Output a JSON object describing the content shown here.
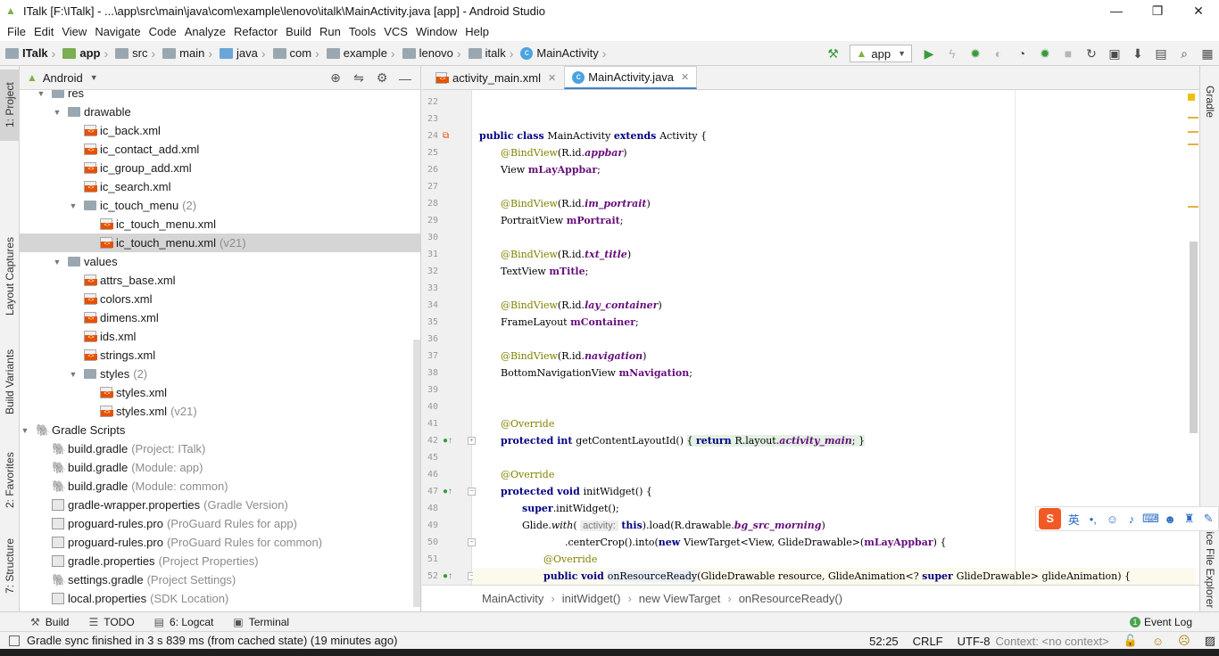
{
  "window": {
    "title": "ITalk [F:\\ITalk] - ...\\app\\src\\main\\java\\com\\example\\lenovo\\italk\\MainActivity.java [app] - Android Studio",
    "minimize": "—",
    "restore": "❐",
    "close": "✕"
  },
  "menu": [
    {
      "label": "File"
    },
    {
      "label": "Edit"
    },
    {
      "label": "View"
    },
    {
      "label": "Navigate"
    },
    {
      "label": "Code"
    },
    {
      "label": "Analyze"
    },
    {
      "label": "Refactor"
    },
    {
      "label": "Build"
    },
    {
      "label": "Run"
    },
    {
      "label": "Tools"
    },
    {
      "label": "VCS"
    },
    {
      "label": "Window"
    },
    {
      "label": "Help"
    }
  ],
  "breadcrumb": [
    {
      "label": "ITalk",
      "icon": "folder-icon"
    },
    {
      "label": "app",
      "icon": "module-folder-icon"
    },
    {
      "label": "src",
      "icon": "folder-icon"
    },
    {
      "label": "main",
      "icon": "folder-icon"
    },
    {
      "label": "java",
      "icon": "source-folder-icon"
    },
    {
      "label": "com",
      "icon": "package-icon"
    },
    {
      "label": "example",
      "icon": "package-icon"
    },
    {
      "label": "lenovo",
      "icon": "package-icon"
    },
    {
      "label": "italk",
      "icon": "package-icon"
    },
    {
      "label": "MainActivity",
      "icon": "class-icon"
    }
  ],
  "run_config": {
    "label": "app"
  },
  "left_tool_tabs": {
    "project": "1: Project",
    "captures": "Layout Captures",
    "variants": "Build Variants",
    "favorites": "2: Favorites",
    "structure": "7: Structure"
  },
  "right_tool_tabs": {
    "gradle": "Gradle",
    "explorer": "Device File Explorer"
  },
  "project_panel": {
    "view": "Android",
    "rows": [
      {
        "label": "res",
        "hint": "",
        "icon": "res-folder-icon"
      },
      {
        "label": "drawable",
        "hint": "",
        "icon": "folder-icon"
      },
      {
        "label": "ic_back.xml",
        "hint": "",
        "icon": "xml-file-icon"
      },
      {
        "label": "ic_contact_add.xml",
        "hint": "",
        "icon": "xml-file-icon"
      },
      {
        "label": "ic_group_add.xml",
        "hint": "",
        "icon": "xml-file-icon"
      },
      {
        "label": "ic_search.xml",
        "hint": "",
        "icon": "xml-file-icon"
      },
      {
        "label": "ic_touch_menu",
        "hint": "(2)",
        "icon": "folder-icon"
      },
      {
        "label": "ic_touch_menu.xml",
        "hint": "",
        "icon": "xml-file-icon"
      },
      {
        "label": "ic_touch_menu.xml",
        "hint": "(v21)",
        "icon": "xml-file-icon"
      },
      {
        "label": "values",
        "hint": "",
        "icon": "folder-icon"
      },
      {
        "label": "attrs_base.xml",
        "hint": "",
        "icon": "xml-file-icon"
      },
      {
        "label": "colors.xml",
        "hint": "",
        "icon": "xml-file-icon"
      },
      {
        "label": "dimens.xml",
        "hint": "",
        "icon": "xml-file-icon"
      },
      {
        "label": "ids.xml",
        "hint": "",
        "icon": "xml-file-icon"
      },
      {
        "label": "strings.xml",
        "hint": "",
        "icon": "xml-file-icon"
      },
      {
        "label": "styles",
        "hint": "(2)",
        "icon": "folder-icon"
      },
      {
        "label": "styles.xml",
        "hint": "",
        "icon": "xml-file-icon"
      },
      {
        "label": "styles.xml",
        "hint": "(v21)",
        "icon": "xml-file-icon"
      },
      {
        "label": "Gradle Scripts",
        "hint": "",
        "icon": "gradle-icon"
      },
      {
        "label": "build.gradle",
        "hint": "(Project: ITalk)",
        "icon": "gradle-icon"
      },
      {
        "label": "build.gradle",
        "hint": "(Module: app)",
        "icon": "gradle-icon"
      },
      {
        "label": "build.gradle",
        "hint": "(Module: common)",
        "icon": "gradle-icon"
      },
      {
        "label": "gradle-wrapper.properties",
        "hint": "(Gradle Version)",
        "icon": "properties-file-icon"
      },
      {
        "label": "proguard-rules.pro",
        "hint": "(ProGuard Rules for app)",
        "icon": "text-file-icon"
      },
      {
        "label": "proguard-rules.pro",
        "hint": "(ProGuard Rules for common)",
        "icon": "text-file-icon"
      },
      {
        "label": "gradle.properties",
        "hint": "(Project Properties)",
        "icon": "properties-file-icon"
      },
      {
        "label": "settings.gradle",
        "hint": "(Project Settings)",
        "icon": "gradle-icon"
      },
      {
        "label": "local.properties",
        "hint": "(SDK Location)",
        "icon": "properties-file-icon"
      }
    ]
  },
  "editor_tabs": [
    {
      "label": "activity_main.xml",
      "active": false
    },
    {
      "label": "MainActivity.java",
      "active": true
    }
  ],
  "code": {
    "line_numbers": [
      "22",
      "23",
      "24",
      "25",
      "26",
      "27",
      "28",
      "29",
      "30",
      "31",
      "32",
      "33",
      "34",
      "35",
      "36",
      "37",
      "38",
      "39",
      "40",
      "41",
      "42",
      "45",
      "46",
      "47",
      "48",
      "49",
      "50",
      "51",
      "52"
    ],
    "inline_hint": "activity:"
  },
  "code_breadcrumb": [
    "MainActivity",
    "initWidget()",
    "new ViewTarget",
    "onResourceReady()"
  ],
  "bottom_tabs": [
    {
      "label": "Build",
      "icon": "hammer-icon"
    },
    {
      "label": "TODO",
      "icon": "list-icon"
    },
    {
      "label": "6: Logcat",
      "icon": "logcat-icon"
    },
    {
      "label": "Terminal",
      "icon": "terminal-icon"
    }
  ],
  "event_log": {
    "label": "Event Log",
    "count": "1"
  },
  "status": {
    "message": "Gradle sync finished in 3 s 839 ms (from cached state) (19 minutes ago)",
    "position": "52:25",
    "line_sep": "CRLF",
    "encoding": "UTF-8",
    "context": "Context: <no context>"
  },
  "ime_bar": {
    "logo": "S",
    "lang": "英"
  }
}
